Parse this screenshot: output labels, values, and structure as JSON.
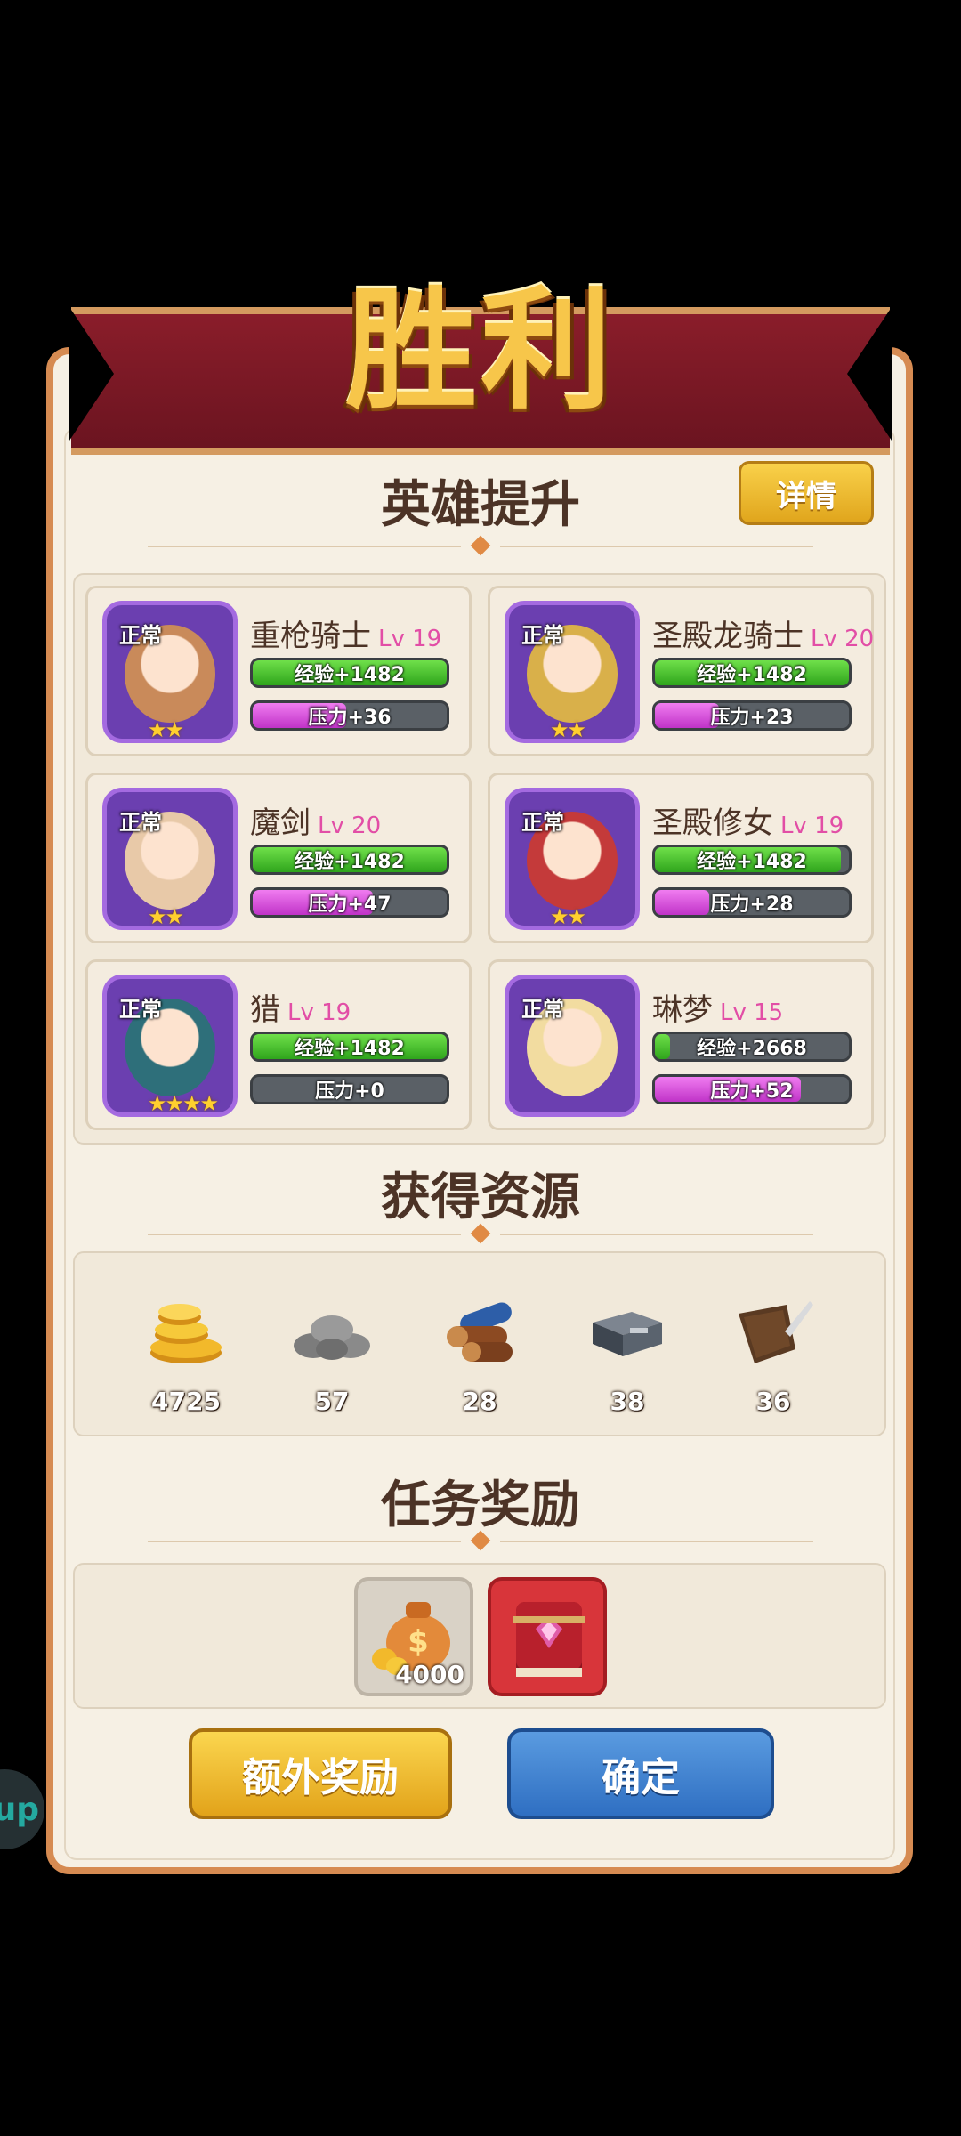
{
  "title": "胜利",
  "sections": {
    "hero": "英雄提升",
    "resources": "获得资源",
    "task": "任务奖励"
  },
  "detail_button": "详情",
  "heroes": [
    {
      "status": "正常",
      "name": "重枪骑士",
      "lv": "Lv 19",
      "exp": "经验+1482",
      "exp_fill": 1.0,
      "stress": "压力+36",
      "stress_fill": 0.48,
      "stars": "★★",
      "color": "#c98a5a"
    },
    {
      "status": "正常",
      "name": "圣殿龙骑士",
      "lv": "Lv 20",
      "exp": "经验+1482",
      "exp_fill": 1.0,
      "stress": "压力+23",
      "stress_fill": 0.33,
      "stars": "★★",
      "color": "#d9b04a"
    },
    {
      "status": "正常",
      "name": "魔剑",
      "lv": "Lv 20",
      "exp": "经验+1482",
      "exp_fill": 1.0,
      "stress": "压力+47",
      "stress_fill": 0.62,
      "stars": "★★",
      "color": "#e8c9a8"
    },
    {
      "status": "正常",
      "name": "圣殿修女",
      "lv": "Lv 19",
      "exp": "经验+1482",
      "exp_fill": 0.96,
      "stress": "压力+28",
      "stress_fill": 0.28,
      "stars": "★★",
      "color": "#c43a3a"
    },
    {
      "status": "正常",
      "name": "猎",
      "lv": "Lv 19",
      "exp": "经验+1482",
      "exp_fill": 1.0,
      "stress": "压力+0",
      "stress_fill": 0.0,
      "stars": "★★★★",
      "color": "#2e6f7a"
    },
    {
      "status": "正常",
      "name": "琳梦",
      "lv": "Lv 15",
      "exp": "经验+2668",
      "exp_fill": 0.08,
      "stress": "压力+52",
      "stress_fill": 0.75,
      "stars": "",
      "color": "#f2dca0"
    }
  ],
  "resources": [
    {
      "icon": "gold-coins-icon",
      "count": "4725"
    },
    {
      "icon": "stone-icon",
      "count": "57"
    },
    {
      "icon": "wood-logs-icon",
      "count": "28"
    },
    {
      "icon": "iron-ingot-icon",
      "count": "38"
    },
    {
      "icon": "leather-icon",
      "count": "36"
    }
  ],
  "task_rewards": [
    {
      "icon": "money-bag-icon",
      "count": "4000"
    },
    {
      "icon": "red-book-icon",
      "count": ""
    }
  ],
  "buttons": {
    "extra": "额外奖励",
    "confirm": "确定"
  },
  "side_badge": "up"
}
